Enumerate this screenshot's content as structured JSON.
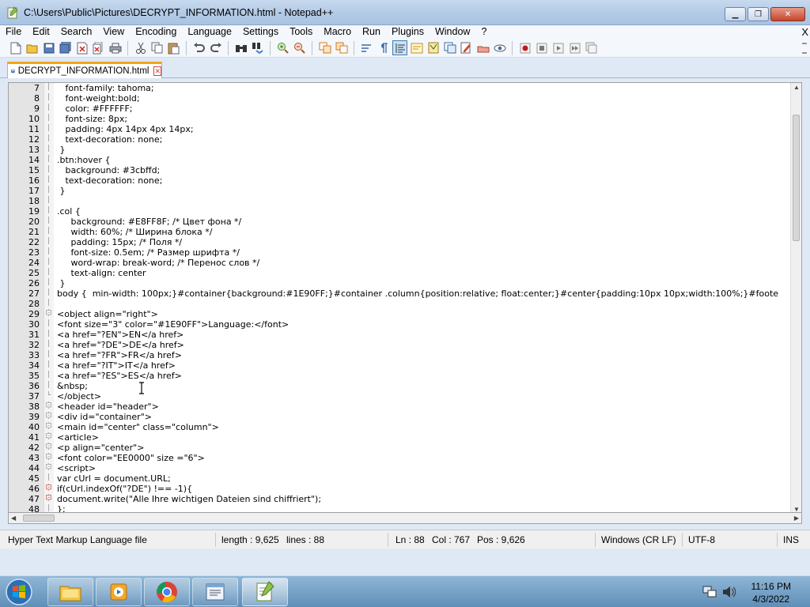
{
  "window": {
    "title": "C:\\Users\\Public\\Pictures\\DECRYPT_INFORMATION.html - Notepad++",
    "minimize_glyph": "▁",
    "maximize_glyph": "❐",
    "close_glyph": "✕"
  },
  "menu": {
    "items": [
      "File",
      "Edit",
      "Search",
      "View",
      "Encoding",
      "Language",
      "Settings",
      "Tools",
      "Macro",
      "Run",
      "Plugins",
      "Window",
      "?"
    ],
    "close_glyph": "X"
  },
  "toolbar": {
    "icons": [
      "new-file-icon",
      "open-file-icon",
      "save-icon",
      "save-all-icon",
      "close-icon",
      "close-all-icon",
      "print-icon",
      "cut-icon",
      "copy-icon",
      "paste-icon",
      "undo-icon",
      "redo-icon",
      "find-icon",
      "replace-icon",
      "zoom-in-icon",
      "zoom-out-icon",
      "sync-vertical-icon",
      "sync-horizontal-icon",
      "word-wrap-icon",
      "show-all-chars-icon",
      "indent-guide-icon",
      "language-icon",
      "doc-map-icon",
      "function-list-icon",
      "folder-workspace-icon",
      "monitoring-icon",
      "record-macro-icon",
      "stop-macro-icon",
      "play-macro-icon",
      "run-macro-multiple-icon",
      "save-macro-icon"
    ]
  },
  "tab": {
    "label": "DECRYPT_INFORMATION.html",
    "close_glyph": "✕"
  },
  "editor": {
    "lines": [
      {
        "n": "7",
        "fold": "line",
        "text": "   font-family: tahoma;"
      },
      {
        "n": "8",
        "fold": "line",
        "text": "   font-weight:bold;"
      },
      {
        "n": "9",
        "fold": "line",
        "text": "   color: #FFFFFF;"
      },
      {
        "n": "10",
        "fold": "line",
        "text": "   font-size: 8px;"
      },
      {
        "n": "11",
        "fold": "line",
        "text": "   padding: 4px 14px 4px 14px;"
      },
      {
        "n": "12",
        "fold": "line",
        "text": "   text-decoration: none;"
      },
      {
        "n": "13",
        "fold": "line",
        "text": " }"
      },
      {
        "n": "14",
        "fold": "line",
        "text": ".btn:hover {"
      },
      {
        "n": "15",
        "fold": "line",
        "text": "   background: #3cbffd;"
      },
      {
        "n": "16",
        "fold": "line",
        "text": "   text-decoration: none;"
      },
      {
        "n": "17",
        "fold": "line",
        "text": " }"
      },
      {
        "n": "18",
        "fold": "line",
        "text": ""
      },
      {
        "n": "19",
        "fold": "line",
        "text": ".col {"
      },
      {
        "n": "20",
        "fold": "line",
        "text": "     background: #E8FF8F; /* Цвет фона */"
      },
      {
        "n": "21",
        "fold": "line",
        "text": "     width: 60%; /* Ширина блока */"
      },
      {
        "n": "22",
        "fold": "line",
        "text": "     padding: 15px; /* Поля */"
      },
      {
        "n": "23",
        "fold": "line",
        "text": "     font-size: 0.5em; /* Размер шрифта */"
      },
      {
        "n": "24",
        "fold": "line",
        "text": "     word-wrap: break-word; /* Перенос слов */"
      },
      {
        "n": "25",
        "fold": "line",
        "text": "     text-align: center"
      },
      {
        "n": "26",
        "fold": "line",
        "text": " }"
      },
      {
        "n": "27",
        "fold": "line",
        "text": "body {  min-width: 100px;}#container{background:#1E90FF;}#container .column{position:relative; float:center;}#center{padding:10px 10px;width:100%;}#foote"
      },
      {
        "n": "28",
        "fold": "line",
        "text": ""
      },
      {
        "n": "29",
        "fold": "open",
        "text": "<object align=\"right\">"
      },
      {
        "n": "30",
        "fold": "line",
        "text": "<font size=\"3\" color=\"#1E90FF\">Language:</font>"
      },
      {
        "n": "31",
        "fold": "line",
        "text": "<a href=\"?EN\">EN</a href>"
      },
      {
        "n": "32",
        "fold": "line",
        "text": "<a href=\"?DE\">DE</a href>"
      },
      {
        "n": "33",
        "fold": "line",
        "text": "<a href=\"?FR\">FR</a href>"
      },
      {
        "n": "34",
        "fold": "line",
        "text": "<a href=\"?IT\">IT</a href>"
      },
      {
        "n": "35",
        "fold": "line",
        "text": "<a href=\"?ES\">ES</a href>"
      },
      {
        "n": "36",
        "fold": "line",
        "text": "&nbsp;"
      },
      {
        "n": "37",
        "fold": "end",
        "text": "</object>"
      },
      {
        "n": "38",
        "fold": "open",
        "text": "<header id=\"header\">"
      },
      {
        "n": "39",
        "fold": "open",
        "text": "<div id=\"container\">"
      },
      {
        "n": "40",
        "fold": "open",
        "text": "<main id=\"center\" class=\"column\">"
      },
      {
        "n": "41",
        "fold": "open",
        "text": "<article>"
      },
      {
        "n": "42",
        "fold": "open",
        "text": "<p align=\"center\">"
      },
      {
        "n": "43",
        "fold": "open",
        "text": "<font color=\"EE0000\" size =\"6\">"
      },
      {
        "n": "44",
        "fold": "open",
        "text": "<script>"
      },
      {
        "n": "45",
        "fold": "line",
        "text": "var cUrl = document.URL;"
      },
      {
        "n": "46",
        "fold": "red",
        "text": "if(cUrl.indexOf(\"?DE\") !== -1){"
      },
      {
        "n": "47",
        "fold": "red",
        "text": "document.write(\"Alle Ihre wichtigen Dateien sind chiffriert\");"
      },
      {
        "n": "48",
        "fold": "line",
        "text": "};"
      }
    ]
  },
  "status": {
    "file_type": "Hyper Text Markup Language file",
    "length": "length : 9,625",
    "lines": "lines : 88",
    "ln": "Ln : 88",
    "col": "Col : 767",
    "pos": "Pos : 9,626",
    "eol": "Windows (CR LF)",
    "encoding": "UTF-8",
    "mode": "INS"
  },
  "taskbar": {
    "apps": [
      "explorer-icon",
      "media-player-icon",
      "chrome-icon",
      "notepad-icon",
      "notepad-plus-plus-icon"
    ],
    "time": "11:16 PM",
    "date": "4/3/2022"
  },
  "colors": {
    "tab_accent": "#f4a21b",
    "fold_red": "#c0392b"
  }
}
